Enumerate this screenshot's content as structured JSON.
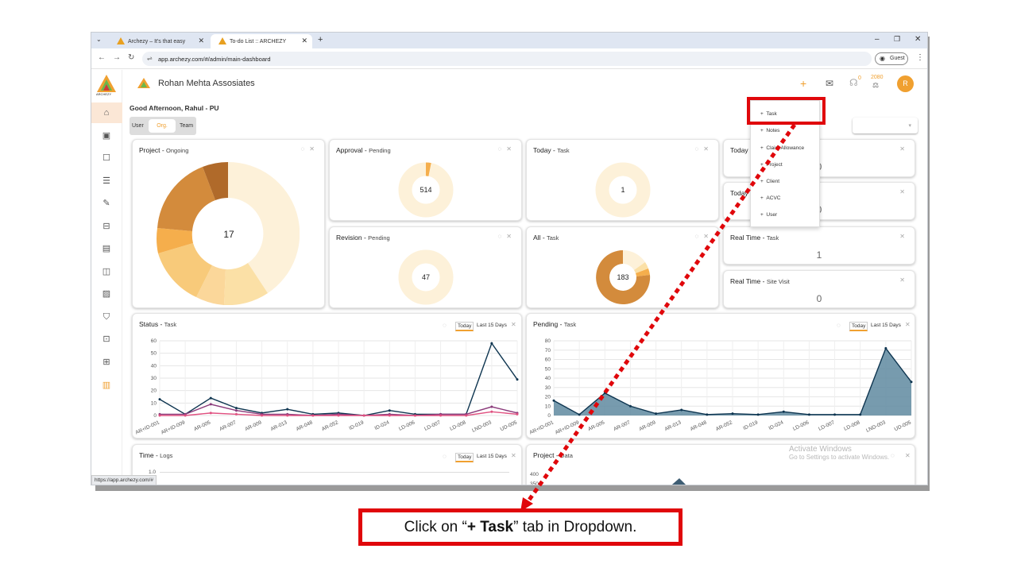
{
  "browser": {
    "tabs": [
      {
        "title": "Archezy – It's that easy"
      },
      {
        "title": "To-do List :: ARCHEZY"
      }
    ],
    "url": "app.archezy.com/#/admin/main-dashboard",
    "profile": "Guest",
    "status_url": "https://app.archezy.com/#"
  },
  "header": {
    "company": "Rohan Mehta Assosiates",
    "logo_text": "ARCHEZY",
    "notif_count": "0",
    "points": "2080",
    "avatar": "R"
  },
  "greeting": "Good Afternoon, Rahul - PU",
  "view_toggle": [
    "User",
    "Org.",
    "Team"
  ],
  "cards": {
    "project": {
      "title": "Project",
      "sub": "Ongoing",
      "value": "17"
    },
    "approval": {
      "title": "Approval",
      "sub": "Pending",
      "value": "514"
    },
    "today_task": {
      "title": "Today",
      "sub": "Task",
      "value": "1"
    },
    "today1": {
      "title": "Today",
      "value": "0"
    },
    "today2": {
      "title": "Today",
      "value": "0"
    },
    "revision": {
      "title": "Revision",
      "sub": "Pending",
      "value": "47"
    },
    "all_task": {
      "title": "All",
      "sub": "Task",
      "value": "183"
    },
    "rt_task": {
      "title": "Real Time",
      "sub": "Task",
      "value": "1"
    },
    "rt_site": {
      "title": "Real Time",
      "sub": "Site Visit",
      "value": "0"
    },
    "status": {
      "title": "Status",
      "sub": "Task"
    },
    "pending": {
      "title": "Pending",
      "sub": "Task"
    },
    "time": {
      "title": "Time",
      "sub": "Logs",
      "ytick": "1.0"
    },
    "project_data": {
      "title": "Project",
      "sub": "Data"
    }
  },
  "segment": {
    "today": "Today",
    "last15": "Last 15 Days"
  },
  "dropdown": [
    "Task",
    "Notes",
    "Claim Allowance",
    "Project",
    "Client",
    "ACVC",
    "User"
  ],
  "chart_data": [
    {
      "type": "line",
      "title": "Status - Task",
      "categories": [
        "AR+ID-001",
        "AR+ID-009",
        "AR-005",
        "AR-007",
        "AR-009",
        "AR-013",
        "AR-048",
        "AR-052",
        "ID-019",
        "ID-024",
        "LD-006",
        "LD-007",
        "LD-008",
        "LND-003",
        "UD-005"
      ],
      "ylim": [
        0,
        60
      ],
      "yticks": [
        0,
        10,
        20,
        30,
        40,
        50,
        60
      ],
      "series": [
        {
          "values": [
            13,
            1,
            14,
            6,
            2,
            5,
            1,
            2,
            0,
            4,
            1,
            1,
            1,
            58,
            29
          ],
          "color": "#0e3550"
        },
        {
          "values": [
            1,
            1,
            9,
            4,
            1,
            1,
            0,
            1,
            0,
            1,
            0,
            1,
            1,
            7,
            2
          ],
          "color": "#8a3a7a"
        },
        {
          "values": [
            0,
            0,
            2,
            1,
            0,
            0,
            0,
            0,
            0,
            0,
            0,
            0,
            0,
            3,
            1
          ],
          "color": "#e05080"
        }
      ]
    },
    {
      "type": "area",
      "title": "Pending - Task",
      "categories": [
        "AR+ID-001",
        "AR+ID-009",
        "AR-005",
        "AR-007",
        "AR-009",
        "AR-013",
        "AR-048",
        "AR-052",
        "ID-019",
        "ID-024",
        "LD-006",
        "LD-007",
        "LD-008",
        "LND-003",
        "UD-005"
      ],
      "ylim": [
        0,
        80
      ],
      "yticks": [
        0,
        10,
        20,
        30,
        40,
        50,
        60,
        70,
        80
      ],
      "series": [
        {
          "values": [
            16,
            1,
            24,
            10,
            2,
            6,
            1,
            2,
            1,
            4,
            1,
            1,
            1,
            72,
            36
          ],
          "color": "#0e3550"
        }
      ]
    }
  ],
  "watermark": {
    "line1": "Activate Windows",
    "line2": "Go to Settings to activate Windows."
  },
  "caption": {
    "pre": "Click on “",
    "bold": "+ Task",
    "post": "” tab in Dropdown."
  },
  "colors": {
    "accent": "#f0a030",
    "red": "#e0070b",
    "navy": "#0e3550"
  }
}
